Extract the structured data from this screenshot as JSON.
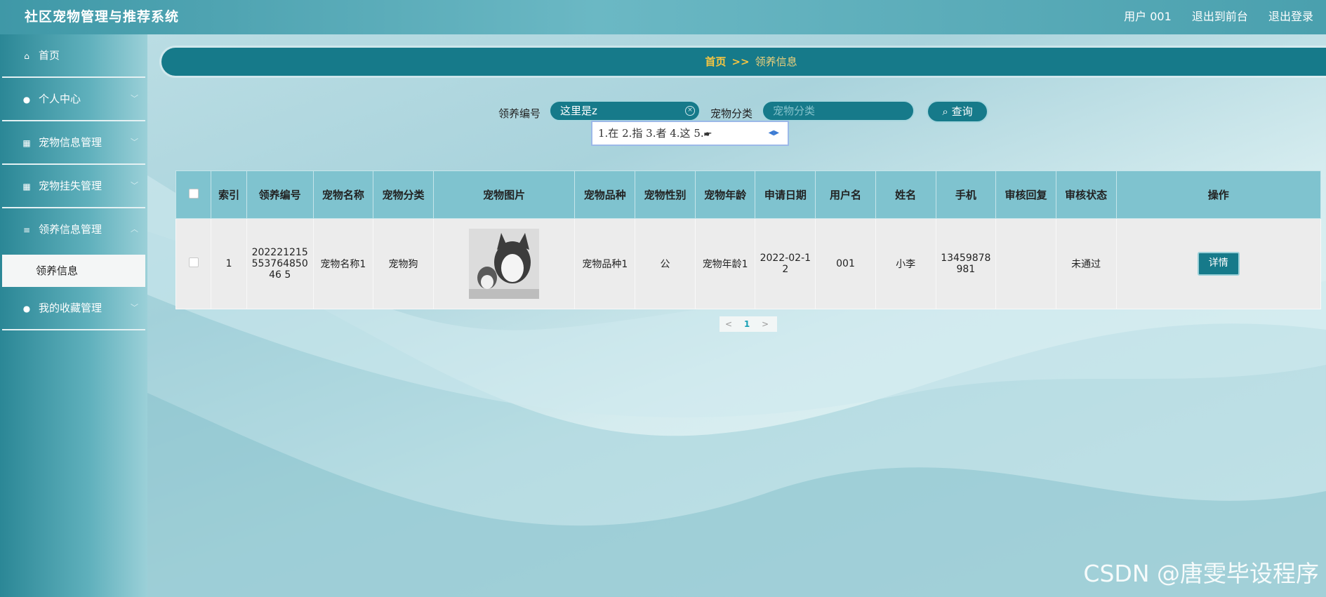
{
  "header": {
    "title": "社区宠物管理与推荐系统",
    "user_label": "用户 001",
    "to_front_label": "退出到前台",
    "logout_label": "退出登录"
  },
  "sidebar": {
    "items": [
      {
        "label": "首页",
        "icon": "home-icon"
      },
      {
        "label": "个人中心",
        "icon": "user-icon"
      },
      {
        "label": "宠物信息管理",
        "icon": "grid-icon"
      },
      {
        "label": "宠物挂失管理",
        "icon": "grid-icon"
      },
      {
        "label": "领养信息管理",
        "icon": "list-icon"
      },
      {
        "label": "我的收藏管理",
        "icon": "pin-icon"
      }
    ],
    "active_sub": "领养信息"
  },
  "breadcrumb": {
    "home": "首页",
    "separator": ">>",
    "current": "领养信息"
  },
  "search": {
    "field1_label": "领养编号",
    "field1_value": "这里是z",
    "field2_label": "宠物分类",
    "field2_placeholder": "宠物分类",
    "query_label": "查询"
  },
  "ime": {
    "candidates": "1.在  2.指  3.者  4.这  5.🖝"
  },
  "table": {
    "headers": [
      "索引",
      "领养编号",
      "宠物名称",
      "宠物分类",
      "宠物图片",
      "宠物品种",
      "宠物性别",
      "宠物年龄",
      "申请日期",
      "用户名",
      "姓名",
      "手机",
      "审核回复",
      "审核状态",
      "操作"
    ],
    "rows": [
      {
        "index": "1",
        "adopt_no": "20222121555376485046 5",
        "pet_name": "宠物名称1",
        "pet_category": "宠物狗",
        "pet_breed": "宠物品种1",
        "pet_gender": "公",
        "pet_age": "宠物年龄1",
        "apply_date": "2022-02-12",
        "username": "001",
        "name": "小李",
        "phone": "13459878981",
        "review_reply": "",
        "review_status": "未通过",
        "action_label": "详情"
      }
    ]
  },
  "pagination": {
    "prev": "<",
    "current": "1",
    "next": ">"
  },
  "watermark": "CSDN @唐雯毕设程序",
  "colors": {
    "accent": "#167a8a",
    "header_th": "#7fc3cf",
    "breadcrumb_home": "#f5c542"
  }
}
